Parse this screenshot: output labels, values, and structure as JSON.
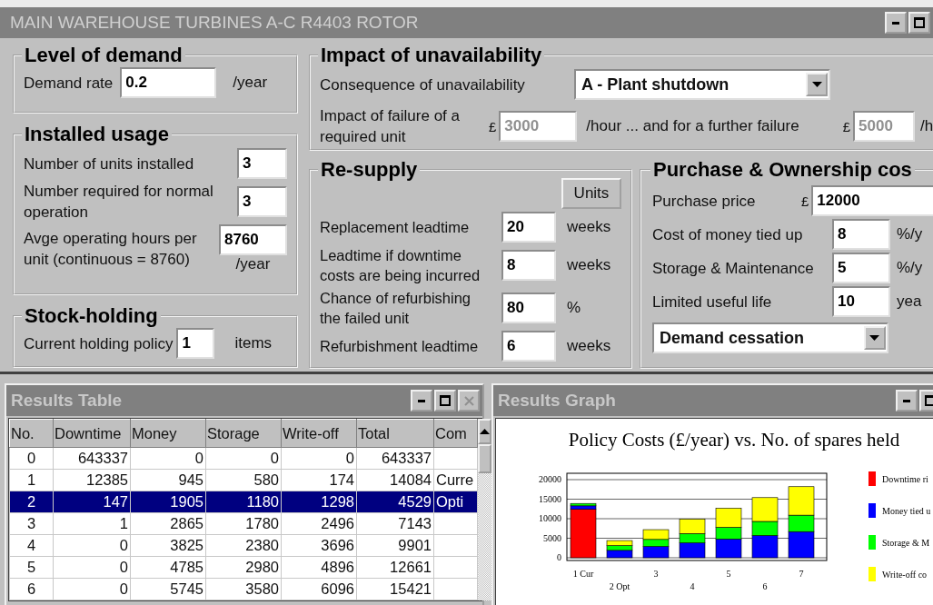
{
  "window": {
    "title": "MAIN WAREHOUSE TURBINES A-C R4403 ROTOR"
  },
  "demand": {
    "title": "Level of demand",
    "label": "Demand rate",
    "value": "0.2",
    "unit": "/year"
  },
  "usage": {
    "title": "Installed usage",
    "rows": [
      {
        "label": "Number of units installed",
        "value": "3"
      },
      {
        "label": "Number required for normal operation",
        "value": "3"
      },
      {
        "label": "Avge operating hours per unit (continuous = 8760)",
        "value": "8760",
        "unit": "/year"
      }
    ]
  },
  "stock": {
    "title": "Stock-holding",
    "label": "Current holding policy",
    "value": "1",
    "unit": "items"
  },
  "impact": {
    "title": "Impact of unavailability",
    "consequence_label": "Consequence of unavailability",
    "consequence": "A - Plant shutdown",
    "failure_label": "Impact of failure of a required unit",
    "currency": "£",
    "cost": {
      "value": "3000",
      "disabled": true
    },
    "cost_unit": "/hour ... and for a further failure",
    "further_currency": "£",
    "further_cost": {
      "value": "5000",
      "disabled": true
    },
    "further_unit": "/h"
  },
  "resupply": {
    "title": "Re-supply",
    "button": "Units",
    "rows": [
      {
        "label": "Replacement leadtime",
        "value": "20",
        "unit": "weeks"
      },
      {
        "label": "Leadtime if downtime costs are being incurred",
        "value": "8",
        "unit": "weeks"
      },
      {
        "label": "Chance of refurbishing the failed unit",
        "value": "80",
        "unit": "%"
      },
      {
        "label": "Refurbishment leadtime",
        "value": "6",
        "unit": "weeks"
      }
    ]
  },
  "purchase": {
    "title": "Purchase & Ownership cos",
    "price_label": "Purchase price",
    "currency": "£",
    "price": "12000",
    "rows": [
      {
        "label": "Cost of money tied up",
        "value": "8",
        "unit": "%/y"
      },
      {
        "label": "Storage & Maintenance",
        "value": "5",
        "unit": "%/y"
      },
      {
        "label": "Limited useful life",
        "value": "10",
        "unit": "yea"
      }
    ],
    "dropdown": "Demand cessation"
  },
  "results_table": {
    "title": "Results Table",
    "columns": [
      "No.",
      "Downtime",
      "Money",
      "Storage",
      "Write-off",
      "Total",
      "Com"
    ],
    "rows": [
      {
        "cells": [
          "0",
          "643337",
          "0",
          "0",
          "0",
          "643337"
        ],
        "selected": false
      },
      {
        "cells": [
          "1",
          "12385",
          "945",
          "580",
          "174",
          "14084"
        ],
        "comment": "Curre",
        "selected": false
      },
      {
        "cells": [
          "2",
          "147",
          "1905",
          "1180",
          "1298",
          "4529"
        ],
        "comment": "Opti",
        "selected": true
      },
      {
        "cells": [
          "3",
          "1",
          "2865",
          "1780",
          "2496",
          "7143"
        ],
        "selected": false
      },
      {
        "cells": [
          "4",
          "0",
          "3825",
          "2380",
          "3696",
          "9901"
        ],
        "selected": false
      },
      {
        "cells": [
          "5",
          "0",
          "4785",
          "2980",
          "4896",
          "12661"
        ],
        "selected": false
      },
      {
        "cells": [
          "6",
          "0",
          "5745",
          "3580",
          "6096",
          "15421"
        ],
        "selected": false
      }
    ]
  },
  "results_graph": {
    "title": "Results Graph",
    "chart_data": {
      "type": "bar",
      "title": "Policy Costs (£/year) vs. No. of spares held",
      "stacked": true,
      "grid": true,
      "legend": true,
      "categories": [
        "1 Cur",
        "2 Opt",
        "3",
        "4",
        "5",
        "6",
        "7"
      ],
      "ylim": [
        0,
        20000
      ],
      "yticks": [
        0,
        5000,
        10000,
        15000,
        20000
      ],
      "series": [
        {
          "name": "Downtime ri",
          "color": "#ff0000",
          "values": [
            12400,
            null,
            0,
            0,
            0,
            0,
            0
          ]
        },
        {
          "name": "Money tied u",
          "color": "#0000ff",
          "values": [
            900,
            1900,
            2900,
            3800,
            4800,
            5700,
            6700
          ]
        },
        {
          "name": "Storage & M",
          "color": "#00ff00",
          "values": [
            600,
            1200,
            1800,
            2400,
            3000,
            3600,
            4200
          ]
        },
        {
          "name": "Write-off co",
          "color": "#ffff00",
          "values": [
            null,
            1300,
            2500,
            3700,
            4900,
            6100,
            7300
          ]
        }
      ]
    }
  }
}
